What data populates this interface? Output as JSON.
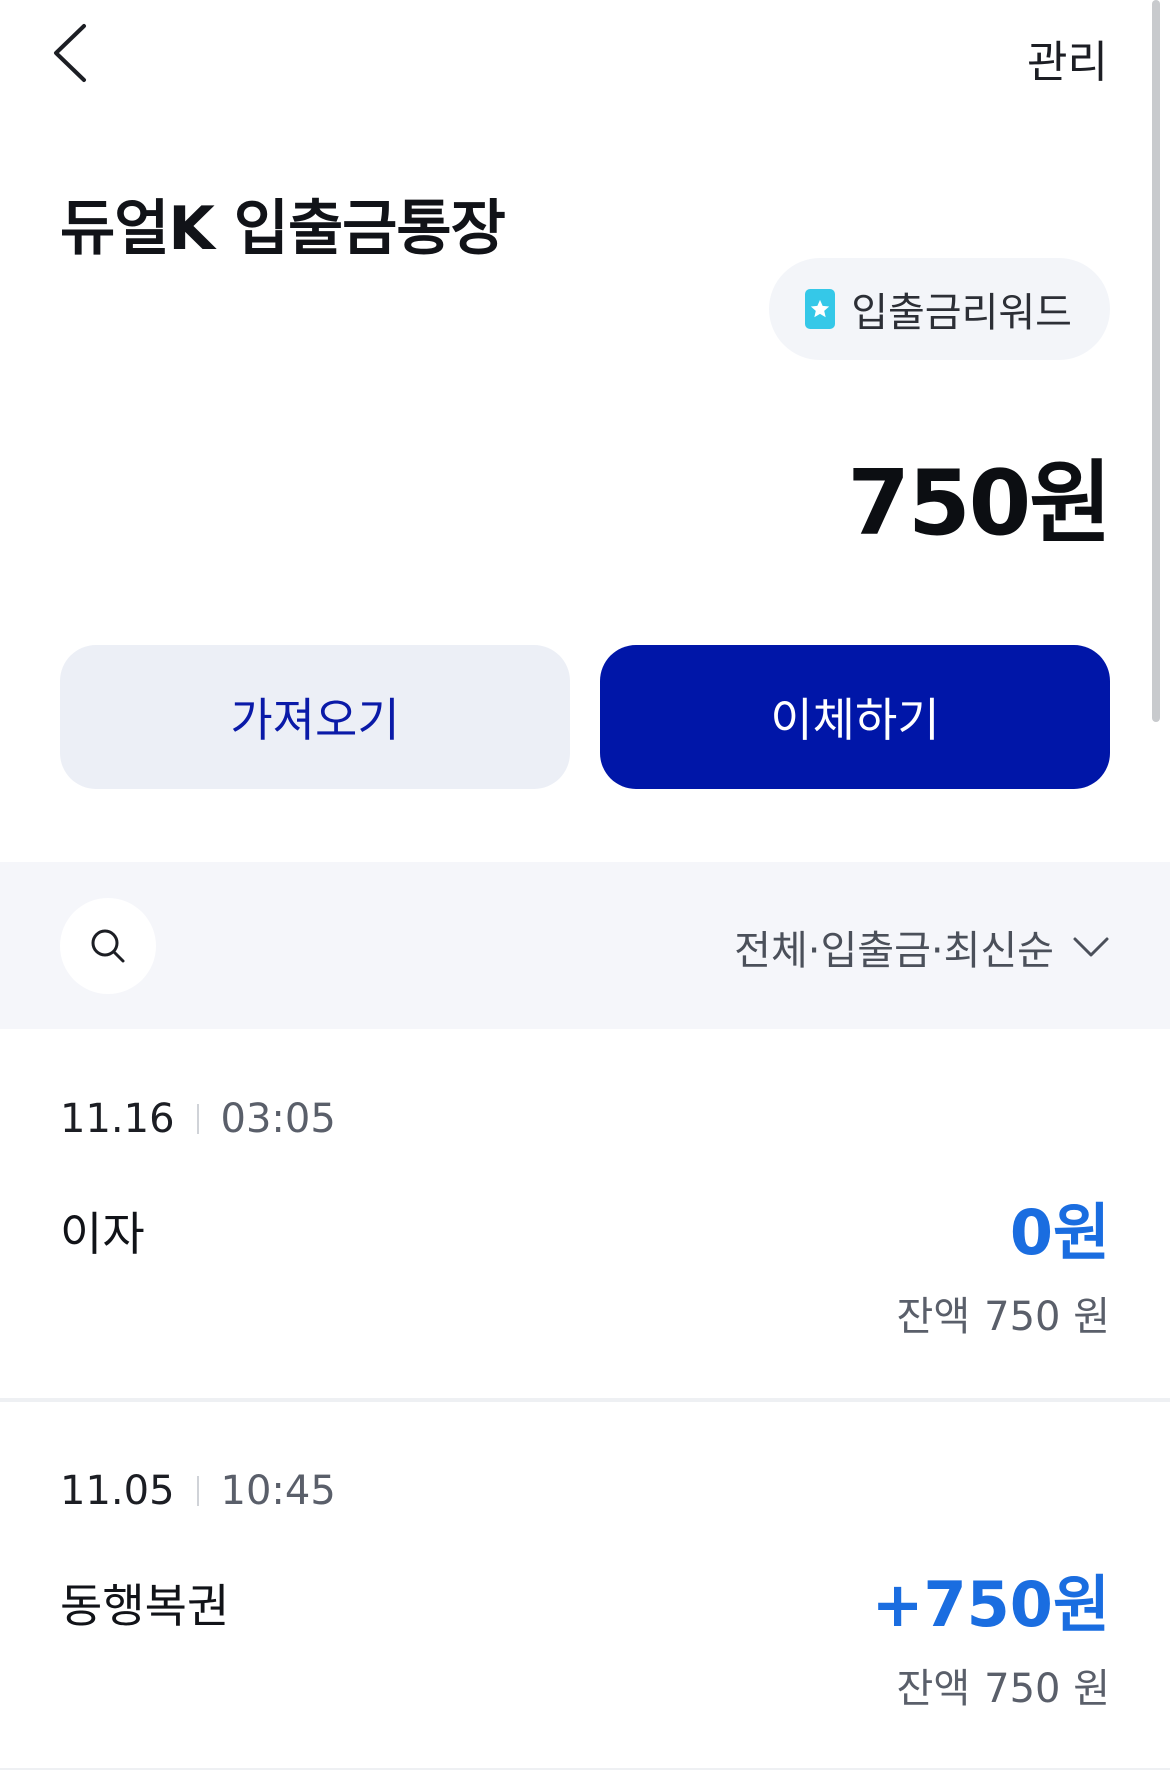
{
  "header": {
    "back_icon": "chevron-left-icon",
    "manage_label": "관리"
  },
  "account": {
    "title": "듀얼K 입출금통장",
    "reward_label": "입출금리워드",
    "reward_icon": "star-badge-icon",
    "balance": "750원"
  },
  "actions": {
    "fetch_label": "가져오기",
    "transfer_label": "이체하기"
  },
  "filter": {
    "search_icon": "search-icon",
    "label": "전체·입출금·최신순",
    "dropdown_icon": "chevron-down-icon"
  },
  "transactions": [
    {
      "date": "11.16",
      "time": "03:05",
      "name": "이자",
      "amount": "0원",
      "balance_label": "잔액",
      "balance_value": "750 원"
    },
    {
      "date": "11.05",
      "time": "10:45",
      "name": "동행복권",
      "amount": "+750원",
      "balance_label": "잔액",
      "balance_value": "750 원"
    }
  ],
  "colors": {
    "primary": "#0016a8",
    "secondary_bg": "#eceff6",
    "amount_blue": "#1a6de0",
    "reward_icon": "#35c8e8",
    "filter_bg": "#f5f6fa"
  }
}
